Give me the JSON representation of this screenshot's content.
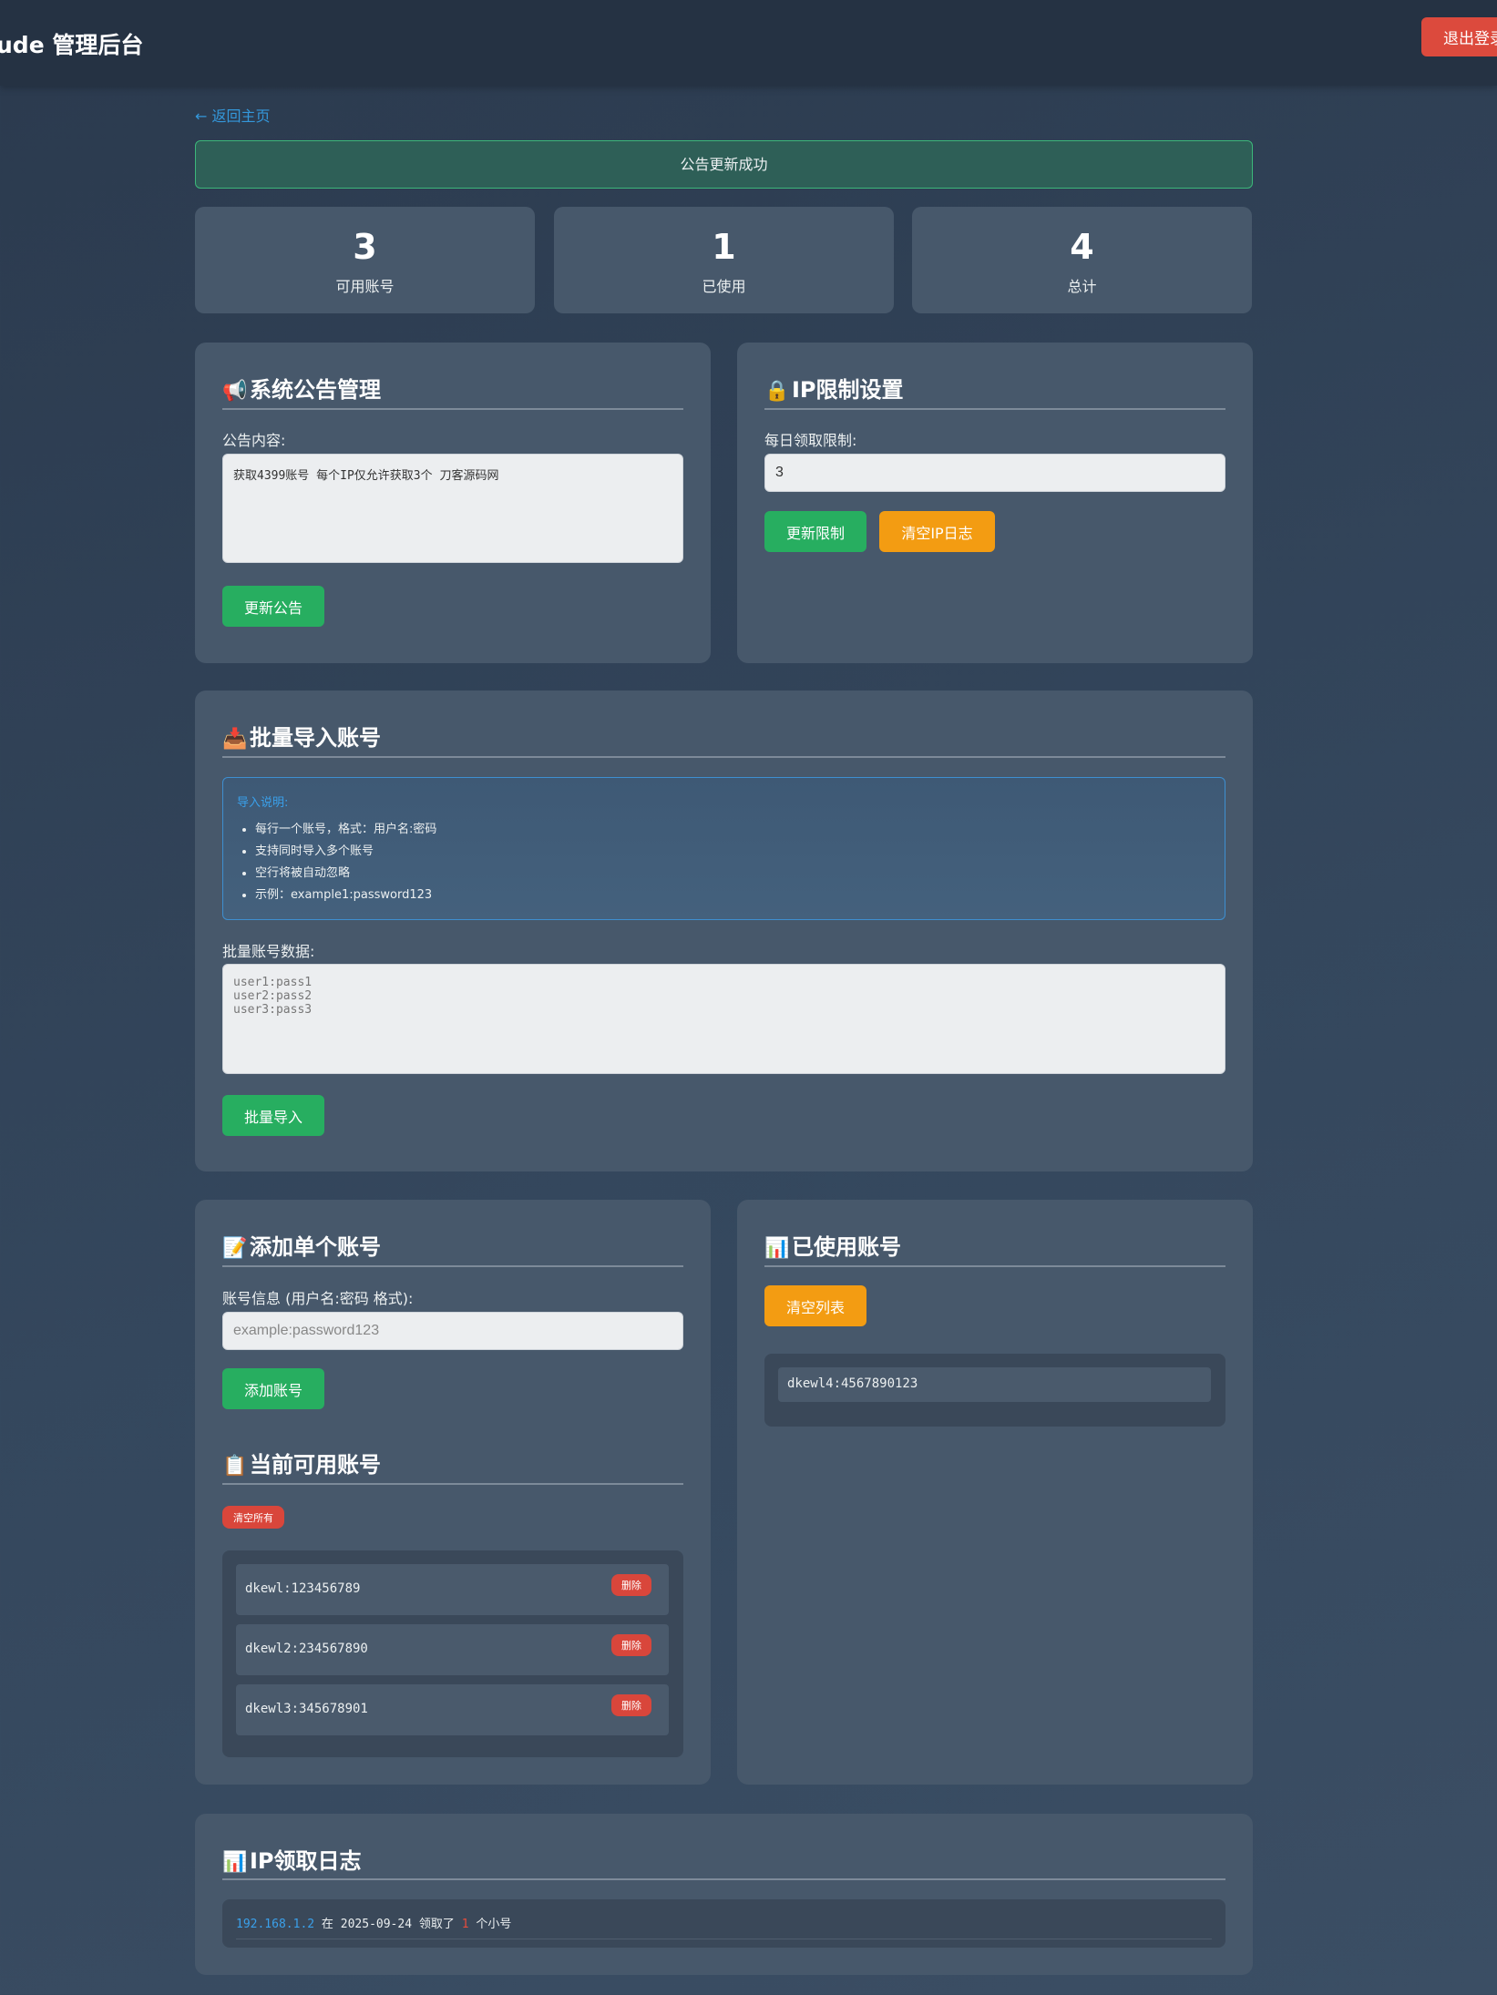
{
  "header": {
    "title": "ude 管理后台",
    "logout_label": "退出登录"
  },
  "back_link": "← 返回主页",
  "alert": "公告更新成功",
  "stats": [
    {
      "value": "3",
      "label": "可用账号"
    },
    {
      "value": "1",
      "label": "已使用"
    },
    {
      "value": "4",
      "label": "总计"
    }
  ],
  "announcement": {
    "icon": "megaphone-icon",
    "title": "系统公告管理",
    "label": "公告内容:",
    "content": "获取4399账号 每个IP仅允许获取3个 刀客源码网",
    "button": "更新公告"
  },
  "ip_limit": {
    "icon": "lock-icon",
    "title": "IP限制设置",
    "label": "每日领取限制:",
    "value": "3",
    "update_button": "更新限制",
    "clear_button": "清空IP日志"
  },
  "batch_import": {
    "icon": "inbox-tray-icon",
    "title": "批量导入账号",
    "info_title": "导入说明:",
    "info_items": [
      "每行一个账号，格式：用户名:密码",
      "支持同时导入多个账号",
      "空行将被自动忽略",
      "示例：example1:password123"
    ],
    "label": "批量账号数据:",
    "placeholder": "user1:pass1\nuser2:pass2\nuser3:pass3",
    "button": "批量导入"
  },
  "add_single": {
    "icon": "memo-icon",
    "title": "添加单个账号",
    "label": "账号信息 (用户名:密码 格式):",
    "placeholder": "example:password123",
    "button": "添加账号"
  },
  "available": {
    "icon": "clipboard-icon",
    "title": "当前可用账号",
    "clear_all": "清空所有",
    "delete_label": "删除",
    "accounts": [
      "dkewl:123456789",
      "dkewl2:234567890",
      "dkewl3:345678901"
    ]
  },
  "used": {
    "icon": "bar-chart-icon",
    "title": "已使用账号",
    "clear_button": "清空列表",
    "accounts": [
      "dkewl4:4567890123"
    ]
  },
  "ip_log": {
    "icon": "bar-chart-icon",
    "title": "IP领取日志",
    "entries": [
      {
        "ip": "192.168.1.2",
        "at": "在",
        "date": "2025-09-24",
        "took": "领取了",
        "count": "1",
        "unit": "个小号"
      }
    ]
  },
  "colors": {
    "accent_green": "#27ae60",
    "accent_orange": "#f39c12",
    "accent_red": "#dc4a3d",
    "link_blue": "#3498db",
    "panel": "#47586b"
  }
}
